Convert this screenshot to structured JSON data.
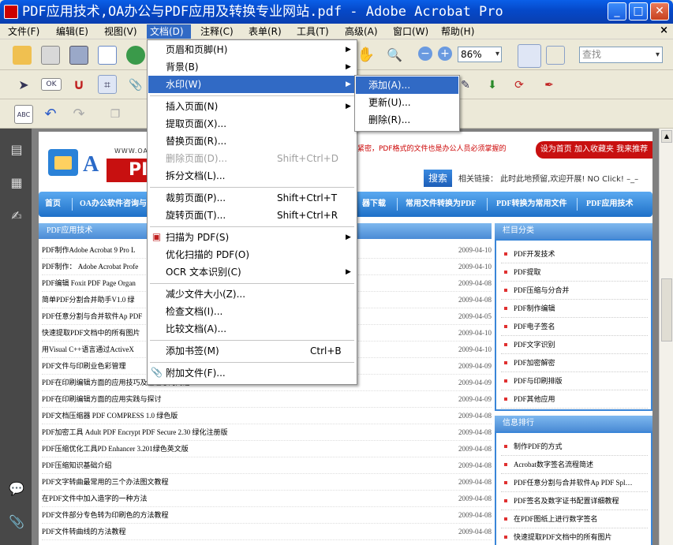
{
  "window": {
    "title": "PDF应用技术,OA办公与PDF应用及转换专业网站.pdf - Adobe Acrobat Pro",
    "minimize": "_",
    "maximize": "□",
    "close": "✕"
  },
  "menubar": {
    "items": [
      "文件(F)",
      "编辑(E)",
      "视图(V)",
      "文档(D)",
      "注释(C)",
      "表单(R)",
      "工具(T)",
      "高级(A)",
      "窗口(W)",
      "帮助(H)"
    ],
    "close_glyph": "×"
  },
  "toolbar": {
    "zoom": "86%",
    "search_placeholder": "查找"
  },
  "icons": {
    "open": "folder-icon",
    "print": "printer-icon",
    "save": "disk-icon",
    "email": "mail-icon",
    "hand": "hand-icon",
    "zoom": "magnifier-icon",
    "select": "arrow-icon",
    "ok": "OK"
  },
  "document_menu": {
    "items": [
      {
        "label": "页眉和页脚(H)",
        "submenu": true
      },
      {
        "label": "背景(B)",
        "submenu": true
      },
      {
        "label": "水印(W)",
        "submenu": true,
        "highlighted": true
      },
      {
        "label": "插入页面(N)",
        "submenu": true
      },
      {
        "label": "提取页面(X)..."
      },
      {
        "label": "替换页面(R)..."
      },
      {
        "label": "删除页面(D)...",
        "shortcut": "Shift+Ctrl+D",
        "disabled": true
      },
      {
        "label": "拆分文档(L)..."
      },
      {
        "label": "裁剪页面(P)...",
        "shortcut": "Shift+Ctrl+T"
      },
      {
        "label": "旋转页面(T)...",
        "shortcut": "Shift+Ctrl+R"
      },
      {
        "label": "扫描为 PDF(S)",
        "submenu": true
      },
      {
        "label": "优化扫描的 PDF(O)"
      },
      {
        "label": "OCR 文本识别(C)",
        "submenu": true
      },
      {
        "label": "减少文件大小(Z)..."
      },
      {
        "label": "检查文档(I)..."
      },
      {
        "label": "比较文档(A)..."
      },
      {
        "label": "添加书签(M)",
        "shortcut": "Ctrl+B"
      },
      {
        "label": "附加文件(F)..."
      }
    ],
    "submenu_arrow": "▶"
  },
  "watermark_submenu": {
    "items": [
      "添加(A)...",
      "更新(U)...",
      "删除(R)..."
    ]
  },
  "webpage": {
    "domain": "WWW.OA",
    "logo_a": "A",
    "logo_pf": "PI",
    "marquee": "系紧密，PDF格式的文件也是办公人员必须掌握的",
    "fav": "设为首页 加入收藏夹 我来推荐",
    "search_btn": "搜索",
    "related": "相关链接： 此时此地预留,欢迎开展! NO Click! –_–",
    "nav": [
      "首页",
      "OA办公软件咨询与",
      "器下载",
      "常用文件转换为PDF",
      "PDF转换为常用文件",
      "PDF应用技术"
    ],
    "section_title": "PDF应用技术",
    "articles": [
      {
        "title": "PDF制作Adobe Acrobat 9 Pro L",
        "date": "2009-04-10"
      },
      {
        "title": "PDF制作： Adobe Acrobat Profe",
        "date": "2009-04-10"
      },
      {
        "title": "PDF编辑 Foxit PDF Page Organ",
        "date": "2009-04-08"
      },
      {
        "title": "简单PDF分割合并助手V1.0 绿",
        "date": "2009-04-08"
      },
      {
        "title": "PDF任意分割与合并软件Ap PDF",
        "date": "2009-04-05"
      },
      {
        "title": "快速提取PDF文档中的所有图片",
        "date": "2009-04-10"
      },
      {
        "title": "用Visual C++语言通过ActiveX",
        "date": "2009-04-10"
      },
      {
        "title": "PDF文件与印刷业色彩管理",
        "date": "2009-04-09"
      },
      {
        "title": "PDF在印刷编辑方面的应用技巧及应注意的问题",
        "date": "2009-04-09"
      },
      {
        "title": "PDF在印刷编辑方面的应用实践与探讨",
        "date": "2009-04-09"
      },
      {
        "title": "PDF文档压缩器 PDF COMPRESS 1.0 绿色版",
        "date": "2009-04-08"
      },
      {
        "title": "PDF加密工具 Adult PDF Encrypt PDF Secure 2.30 绿化注册版",
        "date": "2009-04-08"
      },
      {
        "title": "PDF压缩优化工具PD Enhancer 3.201绿色英文版",
        "date": "2009-04-08"
      },
      {
        "title": "PDF压缩知识基础介绍",
        "date": "2009-04-08"
      },
      {
        "title": "PDF文字转曲最常用的三个办法图文教程",
        "date": "2009-04-08"
      },
      {
        "title": "在PDF文件中加入造字的一种方法",
        "date": "2009-04-08"
      },
      {
        "title": "PDF文件部分专色转为印刷色的方法教程",
        "date": "2009-04-08"
      },
      {
        "title": "PDF文件转曲线的方法教程",
        "date": "2009-04-08"
      }
    ],
    "categories_title": "栏目分类",
    "categories": [
      "PDF开发技术",
      "PDF提取",
      "PDF压缩与分合并",
      "PDF制作编辑",
      "PDF电子签名",
      "PDF文字识别",
      "PDF加密解密",
      "PDF与印刷排版",
      "PDF其他应用"
    ],
    "ranking_title": "信息排行",
    "ranking": [
      "制作PDF的方式",
      "Acrobat数字签名流程简述",
      "PDF任意分割与合并软件Ap PDF Spl…",
      "PDF签名及数字证书配置详细教程",
      "在PDF图纸上进行数字签名",
      "快速提取PDF文档中的所有图片"
    ]
  }
}
